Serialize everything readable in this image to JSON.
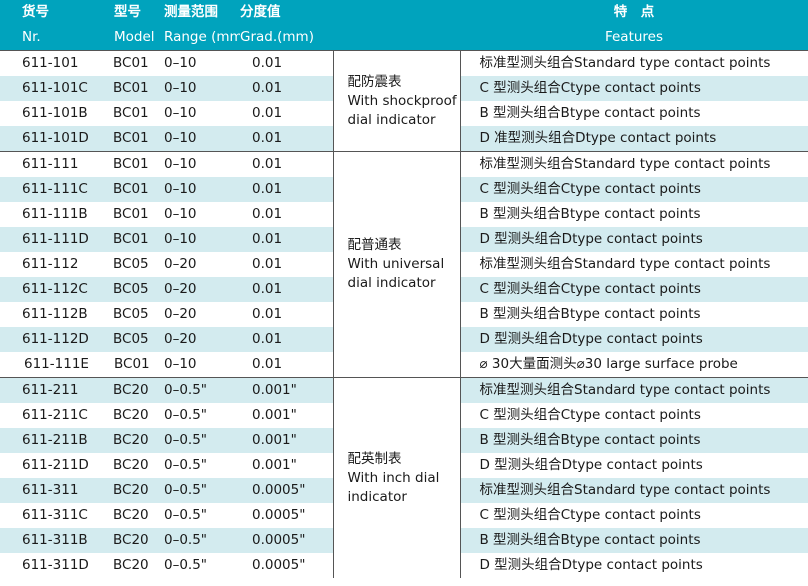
{
  "header": {
    "code_cn": "货号",
    "model_cn": "型号",
    "range_cn": "测量范围",
    "grad_cn": "分度值",
    "features_cn": "特　点",
    "code_en": "Nr.",
    "model_en": "Model",
    "range_en": "Range (mm)",
    "grad_en": "Grad.(mm)",
    "features_en": "Features"
  },
  "sections": [
    {
      "description": "配防震表\nWith shockproof\ndial indicator",
      "rows": [
        {
          "code": "611-101",
          "model": "BC01",
          "range": "0–10",
          "grad": "0.01",
          "feature": "标准型测头组合Standard type contact points"
        },
        {
          "code": "611-101C",
          "model": "BC01",
          "range": "0–10",
          "grad": "0.01",
          "feature": "C 型测头组合Ctype contact points"
        },
        {
          "code": "611-101B",
          "model": "BC01",
          "range": "0–10",
          "grad": "0.01",
          "feature": "B 型测头组合Btype contact points"
        },
        {
          "code": "611-101D",
          "model": "BC01",
          "range": "0–10",
          "grad": "0.01",
          "feature": "D 准型测头组合Dtype contact points"
        }
      ]
    },
    {
      "description": "配普通表\nWith universal\ndial indicator",
      "rows": [
        {
          "code": "611-111",
          "model": "BC01",
          "range": "0–10",
          "grad": "0.01",
          "feature": "标准型测头组合Standard type contact points"
        },
        {
          "code": "611-111C",
          "model": "BC01",
          "range": "0–10",
          "grad": "0.01",
          "feature": "C 型测头组合Ctype contact points"
        },
        {
          "code": "611-111B",
          "model": "BC01",
          "range": "0–10",
          "grad": "0.01",
          "feature": "B 型测头组合Btype contact points"
        },
        {
          "code": "611-111D",
          "model": "BC01",
          "range": "0–10",
          "grad": "0.01",
          "feature": "D 型测头组合Dtype contact points"
        },
        {
          "code": "611-112",
          "model": "BC05",
          "range": "0–20",
          "grad": "0.01",
          "feature": "标准型测头组合Standard type contact points"
        },
        {
          "code": "611-112C",
          "model": "BC05",
          "range": "0–20",
          "grad": "0.01",
          "feature": "C 型测头组合Ctype contact points"
        },
        {
          "code": "611-112B",
          "model": "BC05",
          "range": "0–20",
          "grad": "0.01",
          "feature": "B 型测头组合Btype contact points"
        },
        {
          "code": "611-112D",
          "model": "BC05",
          "range": "0–20",
          "grad": "0.01",
          "feature": "D 型测头组合Dtype contact points"
        },
        {
          "code": "611-111E",
          "model": "BC01",
          "range": "0–10",
          "grad": "0.01",
          "feature": "⌀ 30大量面测头⌀30 large surface probe"
        }
      ]
    },
    {
      "description": "配英制表\nWith inch dial\nindicator",
      "rows": [
        {
          "code": "611-211",
          "model": "BC20",
          "range": "0–0.5\"",
          "grad": "0.001\"",
          "feature": "标准型测头组合Standard type contact points"
        },
        {
          "code": "611-211C",
          "model": "BC20",
          "range": "0–0.5\"",
          "grad": "0.001\"",
          "feature": "C 型测头组合Ctype contact points"
        },
        {
          "code": "611-211B",
          "model": "BC20",
          "range": "0–0.5\"",
          "grad": "0.001\"",
          "feature": "B 型测头组合Btype contact points"
        },
        {
          "code": "611-211D",
          "model": "BC20",
          "range": "0–0.5\"",
          "grad": "0.001\"",
          "feature": "D 型测头组合Dtype contact points"
        },
        {
          "code": "611-311",
          "model": "BC20",
          "range": "0–0.5\"",
          "grad": "0.0005\"",
          "feature": "标准型测头组合Standard type contact points"
        },
        {
          "code": "611-311C",
          "model": "BC20",
          "range": "0–0.5\"",
          "grad": "0.0005\"",
          "feature": "C 型测头组合Ctype contact points"
        },
        {
          "code": "611-311B",
          "model": "BC20",
          "range": "0–0.5\"",
          "grad": "0.0005\"",
          "feature": "B 型测头组合Btype contact points"
        },
        {
          "code": "611-311D",
          "model": "BC20",
          "range": "0–0.5\"",
          "grad": "0.0005\"",
          "feature": "D 型测头组合Dtype contact points"
        }
      ]
    }
  ]
}
